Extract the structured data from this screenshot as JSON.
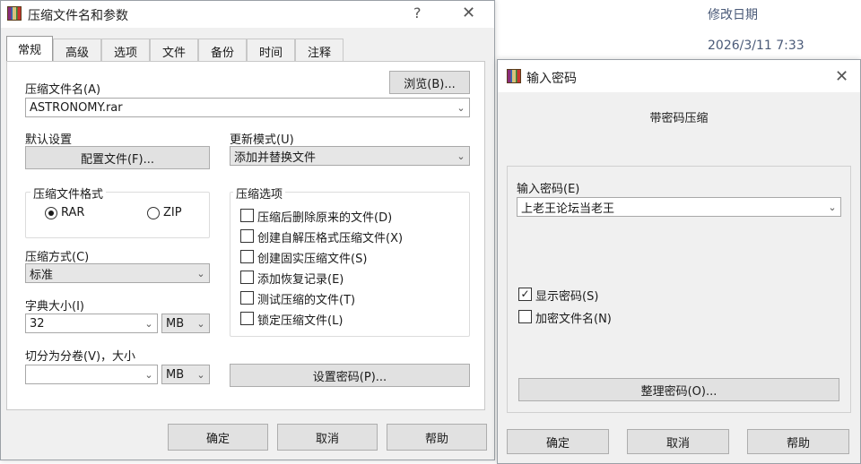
{
  "background": {
    "column_header": "修改日期",
    "date_value": "2026/3/11 7:33"
  },
  "archive_dialog": {
    "title": "压缩文件名和参数",
    "help_glyph": "?",
    "close_glyph": "✕",
    "tabs": [
      "常规",
      "高级",
      "选项",
      "文件",
      "备份",
      "时间",
      "注释"
    ],
    "archive_name_label": "压缩文件名(A)",
    "browse_button": "浏览(B)...",
    "archive_name_value": "ASTRONOMY.rar",
    "default_settings_label": "默认设置",
    "profiles_button": "配置文件(F)...",
    "update_mode_label": "更新模式(U)",
    "update_mode_value": "添加并替换文件",
    "format_group_title": "压缩文件格式",
    "format_rar": "RAR",
    "format_zip": "ZIP",
    "selected_format": "RAR",
    "options_group_title": "压缩选项",
    "options": [
      {
        "label": "压缩后删除原来的文件(D)",
        "checked": false
      },
      {
        "label": "创建自解压格式压缩文件(X)",
        "checked": false
      },
      {
        "label": "创建固实压缩文件(S)",
        "checked": false
      },
      {
        "label": "添加恢复记录(E)",
        "checked": false
      },
      {
        "label": "测试压缩的文件(T)",
        "checked": false
      },
      {
        "label": "锁定压缩文件(L)",
        "checked": false
      }
    ],
    "method_label": "压缩方式(C)",
    "method_value": "标准",
    "dict_label": "字典大小(I)",
    "dict_value": "32",
    "dict_unit": "MB",
    "split_label": "切分为分卷(V)，大小",
    "split_value": "",
    "split_unit": "MB",
    "set_password_button": "设置密码(P)...",
    "ok_button": "确定",
    "cancel_button": "取消",
    "help_button": "帮助"
  },
  "password_dialog": {
    "title": "输入密码",
    "close_glyph": "✕",
    "subtitle": "带密码压缩",
    "password_label": "输入密码(E)",
    "password_value": "上老王论坛当老王",
    "show_password_label": "显示密码(S)",
    "show_password_checked": true,
    "encrypt_names_label": "加密文件名(N)",
    "encrypt_names_checked": false,
    "organize_button": "整理密码(O)...",
    "ok_button": "确定",
    "cancel_button": "取消",
    "help_button": "帮助"
  },
  "icons": {
    "app_icon": "winrar-icon",
    "chevron": "chevron-down-icon",
    "check_glyph": "✓"
  }
}
